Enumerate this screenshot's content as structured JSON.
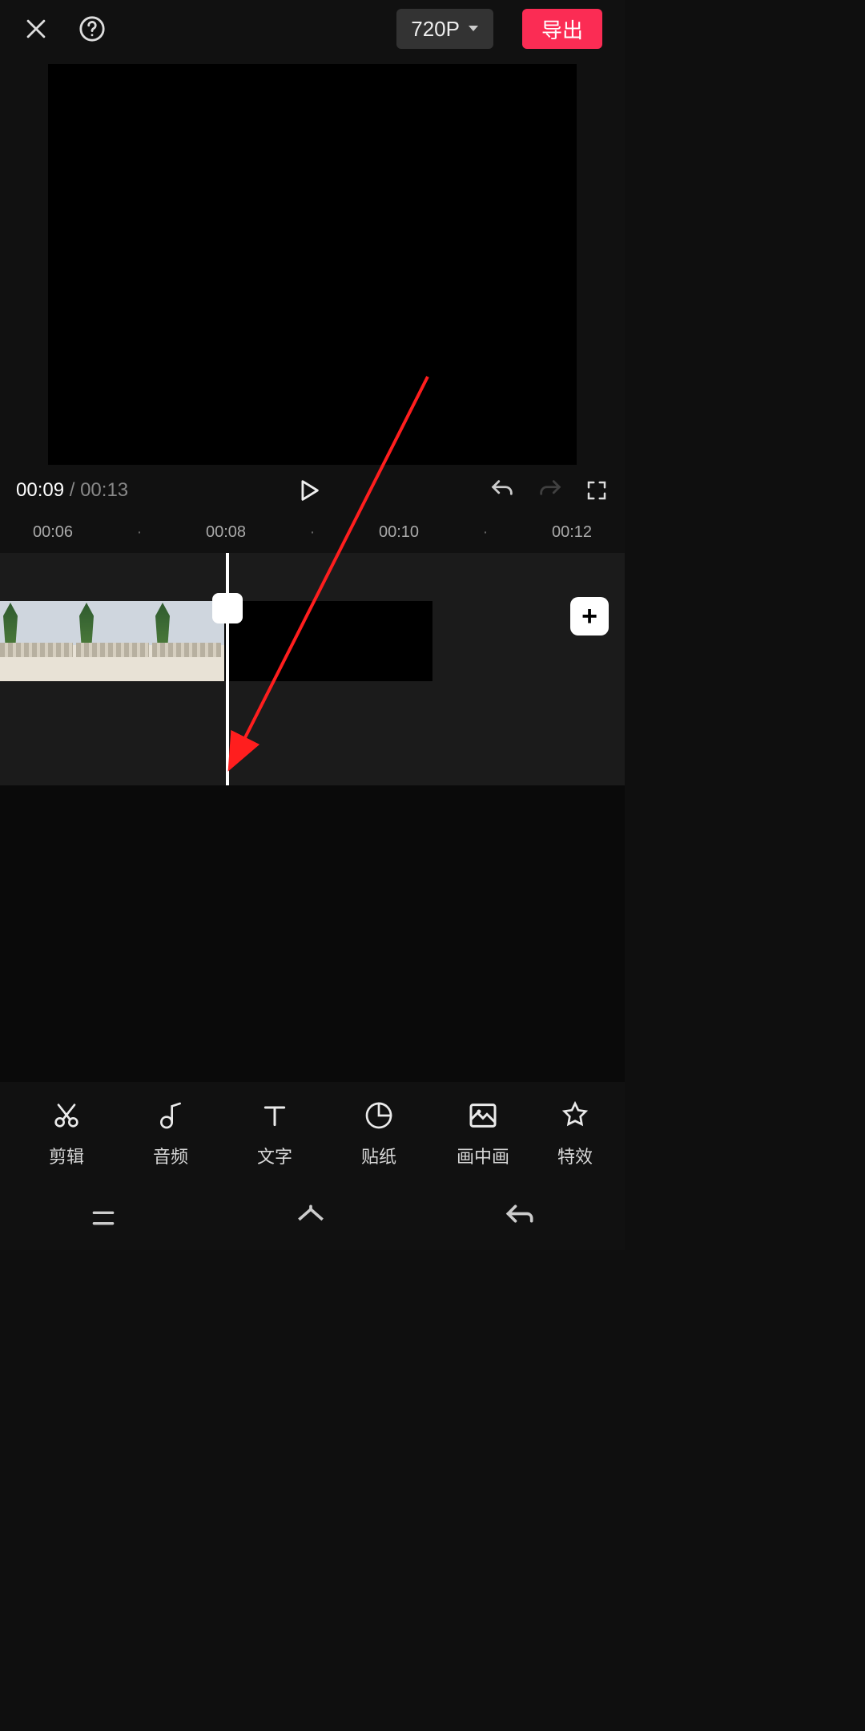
{
  "header": {
    "resolution": "720P",
    "export_label": "导出"
  },
  "playback": {
    "current": "00:09",
    "duration": "00:13"
  },
  "ruler": [
    "00:06",
    "00:08",
    "00:10",
    "00:12"
  ],
  "add_clip_label": "+",
  "tools": [
    {
      "key": "cut",
      "label": "剪辑"
    },
    {
      "key": "audio",
      "label": "音频"
    },
    {
      "key": "text",
      "label": "文字"
    },
    {
      "key": "sticker",
      "label": "贴纸"
    },
    {
      "key": "pip",
      "label": "画中画"
    },
    {
      "key": "fx",
      "label": "特效"
    }
  ]
}
